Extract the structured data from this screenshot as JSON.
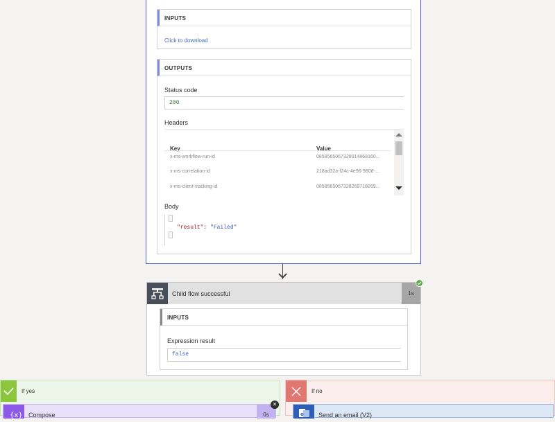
{
  "top_card": {
    "inputs_label": "INPUTS",
    "download_link": "Click to download",
    "outputs_label": "OUTPUTS",
    "status_code_label": "Status code",
    "status_code_value": "200",
    "headers_label": "Headers",
    "headers_columns": {
      "key": "Key",
      "value": "Value"
    },
    "headers_rows": [
      {
        "key": "x-ms-workflow-run-id",
        "value": "08585650673280148681​60..."
      },
      {
        "key": "x-ms-correlation-id",
        "value": "218ad32a-f24c-4e96-9808-..."
      },
      {
        "key": "x-ms-client-tracking-id",
        "value": "085856506732826971826​9..."
      }
    ],
    "body_label": "Body",
    "body_json": {
      "key": "\"result\"",
      "colon": ": ",
      "value": "\"Failed\""
    }
  },
  "condition": {
    "title": "Child flow successful",
    "duration": "1s",
    "inputs_label": "INPUTS",
    "expression_label": "Expression result",
    "expression_value": "false"
  },
  "branches": {
    "yes_label": "If yes",
    "no_label": "If no",
    "compose_title": "Compose",
    "compose_duration": "0s",
    "email_title": "Send an email (V2)"
  },
  "colors": {
    "accent": "#4f5bd5",
    "success": "#5fa84a",
    "yes_branch": "#8cc63f",
    "no_branch": "#e07871",
    "compose": "#8c5ae6",
    "outlook": "#2f5db6"
  }
}
